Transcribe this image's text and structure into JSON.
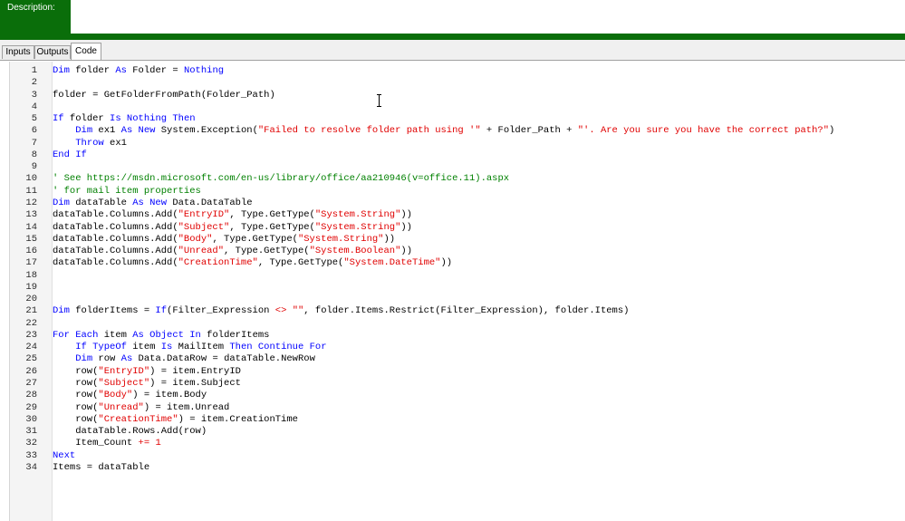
{
  "description": {
    "label": "Description:",
    "value": ""
  },
  "tabs": [
    {
      "label": "Inputs",
      "active": false
    },
    {
      "label": "Outputs",
      "active": false
    },
    {
      "label": "Code",
      "active": true
    }
  ],
  "colors": {
    "header_green": "#0a6e0a",
    "keyword": "#0000ff",
    "string": "#e00000",
    "comment": "#008000"
  },
  "cursor_icon": "text-ibeam-icon",
  "code_lines": [
    {
      "n": "1",
      "tokens": [
        [
          "kw",
          "Dim"
        ],
        [
          "t",
          " folder "
        ],
        [
          "kw",
          "As"
        ],
        [
          "t",
          " Folder = "
        ],
        [
          "kw",
          "Nothing"
        ]
      ]
    },
    {
      "n": "2",
      "tokens": []
    },
    {
      "n": "3",
      "tokens": [
        [
          "t",
          "folder = GetFolderFromPath(Folder_Path)"
        ]
      ]
    },
    {
      "n": "4",
      "tokens": []
    },
    {
      "n": "5",
      "tokens": [
        [
          "kw",
          "If"
        ],
        [
          "t",
          " folder "
        ],
        [
          "kw",
          "Is Nothing Then"
        ]
      ]
    },
    {
      "n": "6",
      "tokens": [
        [
          "t",
          "    "
        ],
        [
          "kw",
          "Dim"
        ],
        [
          "t",
          " ex1 "
        ],
        [
          "kw",
          "As New"
        ],
        [
          "t",
          " System.Exception("
        ],
        [
          "str",
          "\"Failed to resolve folder path using '\""
        ],
        [
          "t",
          " + Folder_Path + "
        ],
        [
          "str",
          "\"'. Are you sure you have the correct path?\""
        ],
        [
          "t",
          ")"
        ]
      ]
    },
    {
      "n": "7",
      "tokens": [
        [
          "t",
          "    "
        ],
        [
          "kw",
          "Throw"
        ],
        [
          "t",
          " ex1"
        ]
      ]
    },
    {
      "n": "8",
      "tokens": [
        [
          "kw",
          "End If"
        ]
      ]
    },
    {
      "n": "9",
      "tokens": []
    },
    {
      "n": "10",
      "tokens": [
        [
          "cm",
          "' See https://msdn.microsoft.com/en-us/library/office/aa210946(v=office.11).aspx"
        ]
      ]
    },
    {
      "n": "11",
      "tokens": [
        [
          "cm",
          "' for mail item properties"
        ]
      ]
    },
    {
      "n": "12",
      "tokens": [
        [
          "kw",
          "Dim"
        ],
        [
          "t",
          " dataTable "
        ],
        [
          "kw",
          "As New"
        ],
        [
          "t",
          " Data.DataTable"
        ]
      ]
    },
    {
      "n": "13",
      "tokens": [
        [
          "t",
          "dataTable.Columns.Add("
        ],
        [
          "str",
          "\"EntryID\""
        ],
        [
          "t",
          ", Type.GetType("
        ],
        [
          "str",
          "\"System.String\""
        ],
        [
          "t",
          "))"
        ]
      ]
    },
    {
      "n": "14",
      "tokens": [
        [
          "t",
          "dataTable.Columns.Add("
        ],
        [
          "str",
          "\"Subject\""
        ],
        [
          "t",
          ", Type.GetType("
        ],
        [
          "str",
          "\"System.String\""
        ],
        [
          "t",
          "))"
        ]
      ]
    },
    {
      "n": "15",
      "tokens": [
        [
          "t",
          "dataTable.Columns.Add("
        ],
        [
          "str",
          "\"Body\""
        ],
        [
          "t",
          ", Type.GetType("
        ],
        [
          "str",
          "\"System.String\""
        ],
        [
          "t",
          "))"
        ]
      ]
    },
    {
      "n": "16",
      "tokens": [
        [
          "t",
          "dataTable.Columns.Add("
        ],
        [
          "str",
          "\"Unread\""
        ],
        [
          "t",
          ", Type.GetType("
        ],
        [
          "str",
          "\"System.Boolean\""
        ],
        [
          "t",
          "))"
        ]
      ]
    },
    {
      "n": "17",
      "tokens": [
        [
          "t",
          "dataTable.Columns.Add("
        ],
        [
          "str",
          "\"CreationTime\""
        ],
        [
          "t",
          ", Type.GetType("
        ],
        [
          "str",
          "\"System.DateTime\""
        ],
        [
          "t",
          "))"
        ]
      ]
    },
    {
      "n": "18",
      "tokens": []
    },
    {
      "n": "19",
      "tokens": []
    },
    {
      "n": "20",
      "tokens": []
    },
    {
      "n": "21",
      "tokens": [
        [
          "kw",
          "Dim"
        ],
        [
          "t",
          " folderItems = "
        ],
        [
          "kw",
          "If"
        ],
        [
          "t",
          "(Filter_Expression "
        ],
        [
          "op",
          "<>"
        ],
        [
          "t",
          " "
        ],
        [
          "str",
          "\"\""
        ],
        [
          "t",
          ", folder.Items.Restrict(Filter_Expression), folder.Items)"
        ]
      ]
    },
    {
      "n": "22",
      "tokens": []
    },
    {
      "n": "23",
      "tokens": [
        [
          "kw",
          "For Each"
        ],
        [
          "t",
          " item "
        ],
        [
          "kw",
          "As Object In"
        ],
        [
          "t",
          " folderItems"
        ]
      ]
    },
    {
      "n": "24",
      "tokens": [
        [
          "t",
          "    "
        ],
        [
          "kw",
          "If TypeOf"
        ],
        [
          "t",
          " item "
        ],
        [
          "kw",
          "Is"
        ],
        [
          "t",
          " MailItem "
        ],
        [
          "kw",
          "Then Continue For"
        ]
      ]
    },
    {
      "n": "25",
      "tokens": [
        [
          "t",
          "    "
        ],
        [
          "kw",
          "Dim"
        ],
        [
          "t",
          " row "
        ],
        [
          "kw",
          "As"
        ],
        [
          "t",
          " Data.DataRow = dataTable.NewRow"
        ]
      ]
    },
    {
      "n": "26",
      "tokens": [
        [
          "t",
          "    row("
        ],
        [
          "str",
          "\"EntryID\""
        ],
        [
          "t",
          ") = item.EntryID"
        ]
      ]
    },
    {
      "n": "27",
      "tokens": [
        [
          "t",
          "    row("
        ],
        [
          "str",
          "\"Subject\""
        ],
        [
          "t",
          ") = item.Subject"
        ]
      ]
    },
    {
      "n": "28",
      "tokens": [
        [
          "t",
          "    row("
        ],
        [
          "str",
          "\"Body\""
        ],
        [
          "t",
          ") = item.Body"
        ]
      ]
    },
    {
      "n": "29",
      "tokens": [
        [
          "t",
          "    row("
        ],
        [
          "str",
          "\"Unread\""
        ],
        [
          "t",
          ") = item.Unread"
        ]
      ]
    },
    {
      "n": "30",
      "tokens": [
        [
          "t",
          "    row("
        ],
        [
          "str",
          "\"CreationTime\""
        ],
        [
          "t",
          ") = item.CreationTime"
        ]
      ]
    },
    {
      "n": "31",
      "tokens": [
        [
          "t",
          "    dataTable.Rows.Add(row)"
        ]
      ]
    },
    {
      "n": "32",
      "tokens": [
        [
          "t",
          "    Item_Count "
        ],
        [
          "op",
          "+="
        ],
        [
          "t",
          " "
        ],
        [
          "num",
          "1"
        ]
      ]
    },
    {
      "n": "33",
      "tokens": [
        [
          "kw",
          "Next"
        ]
      ]
    },
    {
      "n": "34",
      "tokens": [
        [
          "t",
          "Items = dataTable"
        ]
      ]
    }
  ]
}
